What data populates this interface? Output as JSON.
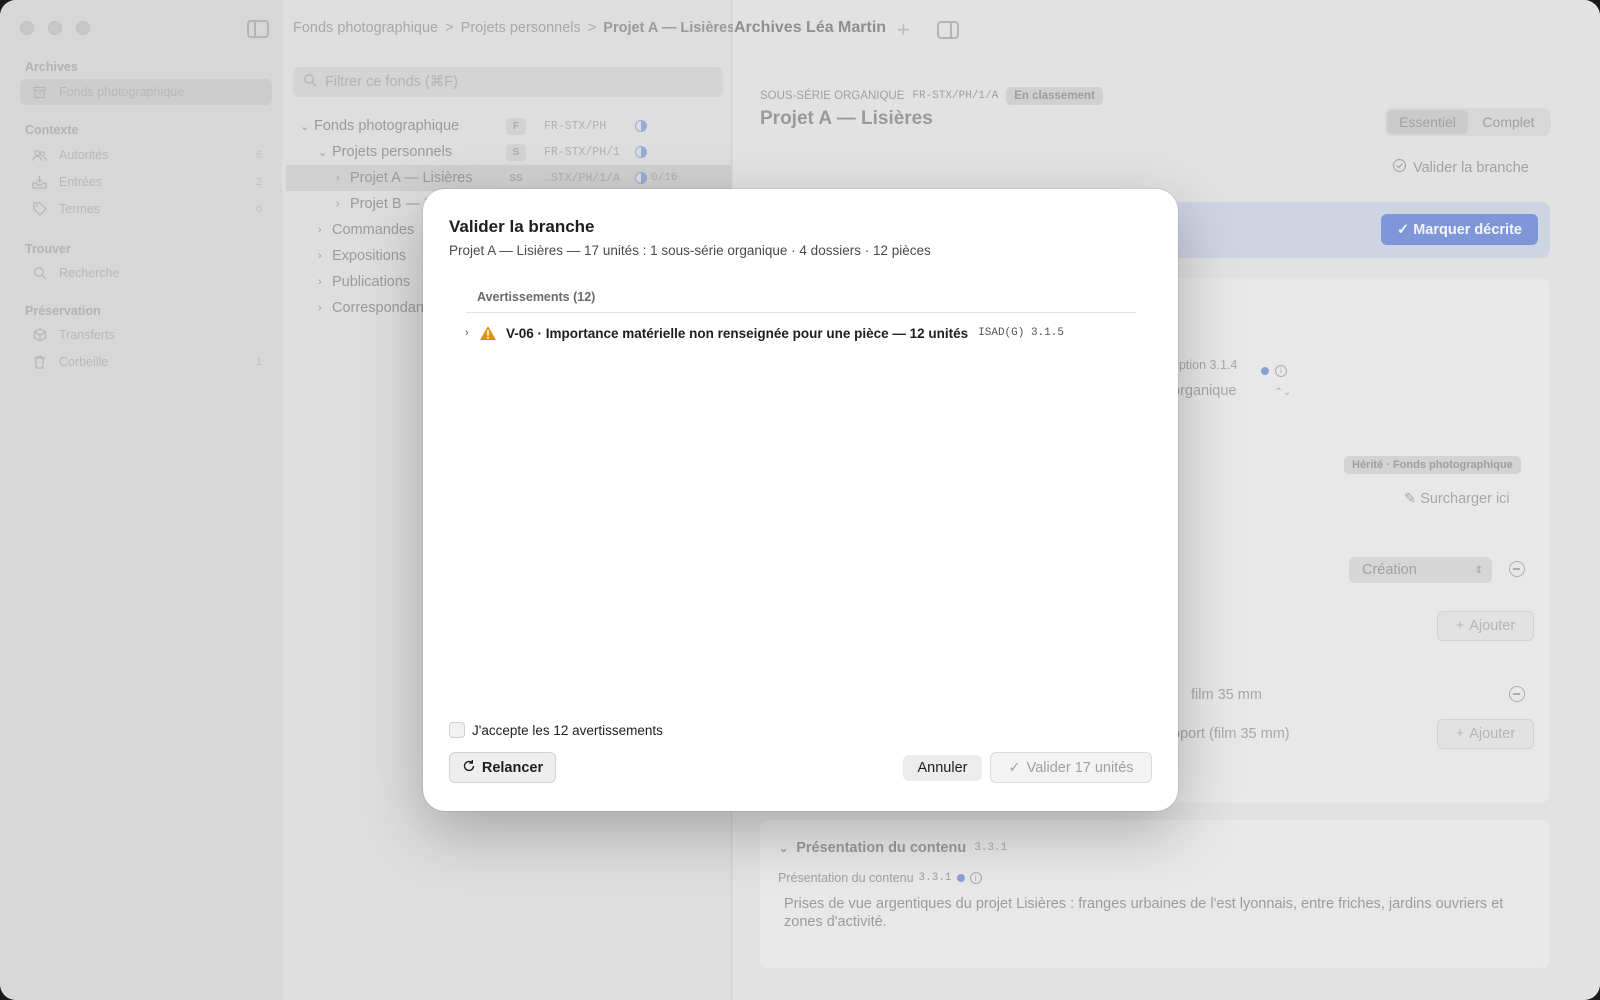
{
  "sidebar": {
    "sections": [
      {
        "title": "Archives"
      },
      {
        "title": "Contexte"
      },
      {
        "title": "Trouver"
      },
      {
        "title": "Préservation"
      }
    ],
    "items": [
      {
        "label": "Fonds photographique",
        "icon": "archive-box-icon",
        "count": ""
      },
      {
        "label": "Autorités",
        "icon": "people-icon",
        "count": "6"
      },
      {
        "label": "Entrées",
        "icon": "inbox-tray-icon",
        "count": "2"
      },
      {
        "label": "Termes",
        "icon": "tag-icon",
        "count": "6"
      },
      {
        "label": "Recherche",
        "icon": "search-icon",
        "count": ""
      },
      {
        "label": "Transferts",
        "icon": "package-icon",
        "count": ""
      },
      {
        "label": "Corbeille",
        "icon": "trash-icon",
        "count": "1"
      }
    ]
  },
  "breadcrumb": {
    "items": [
      "Fonds photographique",
      "Projets personnels",
      "Projet A — Lisières"
    ],
    "separator": ">"
  },
  "list": {
    "filter_placeholder": "Filtrer ce fonds (⌘F)",
    "rows": [
      {
        "label": "Fonds photographique",
        "chevron": "⌄",
        "badge": "F",
        "code": "FR-STX/PH",
        "progress": ""
      },
      {
        "label": "Projets personnels",
        "chevron": "⌄",
        "badge": "S",
        "code": "FR-STX/PH/1",
        "progress": ""
      },
      {
        "label": "Projet A — Lisières",
        "chevron": "›",
        "badge": "SS",
        "code": "…STX/PH/1/A",
        "progress": "0/16"
      },
      {
        "label": "Projet B — L",
        "chevron": "›",
        "badge": "",
        "code": "",
        "progress": ""
      },
      {
        "label": "Commandes",
        "chevron": "›",
        "badge": "",
        "code": "",
        "progress": ""
      },
      {
        "label": "Expositions",
        "chevron": "›",
        "badge": "",
        "code": "",
        "progress": ""
      },
      {
        "label": "Publications",
        "chevron": "›",
        "badge": "",
        "code": "",
        "progress": ""
      },
      {
        "label": "Correspondan",
        "chevron": "›",
        "badge": "",
        "code": "",
        "progress": ""
      }
    ]
  },
  "detail": {
    "window_title": "Archives Léa Martin",
    "level_label": "SOUS-SÉRIE ORGANIQUE",
    "ref_code": "FR-STX/PH/1/A",
    "status_pill": "En classement",
    "title": "Projet A — Lisières",
    "segment": [
      "Essentiel",
      "Complet"
    ],
    "validate_branch": "Valider la branche",
    "mark_described": "✓ Marquer décrite",
    "frag_description": "ription 3.1.4",
    "frag_organique": "organique",
    "inherited_tag": "Hérité · Fonds photographique",
    "override": "Surcharger ici",
    "select_creation": "Création",
    "add_label": "Ajouter",
    "film_text": "film 35 mm",
    "frag_support": "pport (film 35 mm)",
    "section_title": "Présentation du contenu",
    "section_code": "3.3.1",
    "field_label": "Présentation du contenu",
    "field_code": "3.3.1",
    "body": "Prises de vue argentiques du projet Lisières : franges urbaines de l'est lyonnais, entre friches, jardins ouvriers et zones d'activité."
  },
  "modal": {
    "title": "Valider la branche",
    "subtitle": "Projet A — Lisières — 17 unités : 1 sous-série organique · 4 dossiers · 12 pièces",
    "warnings_header": "Avertissements (12)",
    "warning": {
      "text": "V-06 · Importance matérielle non renseignée pour une pièce — 12 unités",
      "ref": "ISAD(G) 3.1.5"
    },
    "accept_label": "J'accepte les 12 avertissements",
    "relancer": "Relancer",
    "annuler": "Annuler",
    "valider": "Valider 17 unités"
  },
  "colors": {
    "accent": "#7f96d8",
    "warning": "#d9930d"
  }
}
